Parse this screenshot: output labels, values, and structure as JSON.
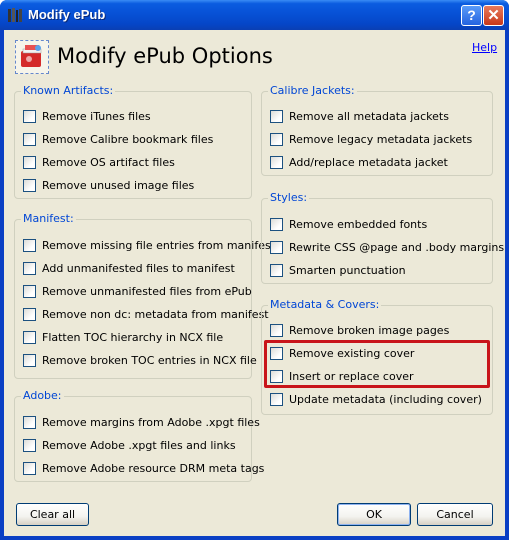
{
  "window": {
    "title": "Modify ePub",
    "help_button": "?",
    "close_button": "✕"
  },
  "header": {
    "title": "Modify ePub Options",
    "help_link": "Help"
  },
  "groups": {
    "known_artifacts": {
      "title": "Known Artifacts:",
      "options": [
        "Remove iTunes files",
        "Remove Calibre bookmark files",
        "Remove OS artifact files",
        "Remove unused image files"
      ]
    },
    "manifest": {
      "title": "Manifest:",
      "options": [
        "Remove missing file entries from manifest",
        "Add unmanifested files to manifest",
        "Remove unmanifested files from ePub",
        "Remove non dc: metadata from manifest",
        "Flatten TOC hierarchy in NCX file",
        "Remove broken TOC entries in NCX file"
      ]
    },
    "adobe": {
      "title": "Adobe:",
      "options": [
        "Remove margins from Adobe .xpgt files",
        "Remove Adobe .xpgt files and links",
        "Remove Adobe resource DRM meta tags"
      ]
    },
    "calibre_jackets": {
      "title": "Calibre Jackets:",
      "options": [
        "Remove all metadata jackets",
        "Remove legacy metadata jackets",
        "Add/replace metadata jacket"
      ]
    },
    "styles": {
      "title": "Styles:",
      "options": [
        "Remove embedded fonts",
        "Rewrite CSS @page and .body margins",
        "Smarten punctuation"
      ]
    },
    "metadata_covers": {
      "title": "Metadata & Covers:",
      "options": [
        "Remove broken image pages",
        "Remove existing cover",
        "Insert or replace cover",
        "Update metadata (including cover)"
      ]
    }
  },
  "buttons": {
    "clear_all": "Clear all",
    "ok": "OK",
    "cancel": "Cancel"
  },
  "colors": {
    "titlebar": "#0751d6",
    "group_title": "#0046d5",
    "highlight": "#c8141a",
    "dialog_bg": "#ece9d8"
  }
}
